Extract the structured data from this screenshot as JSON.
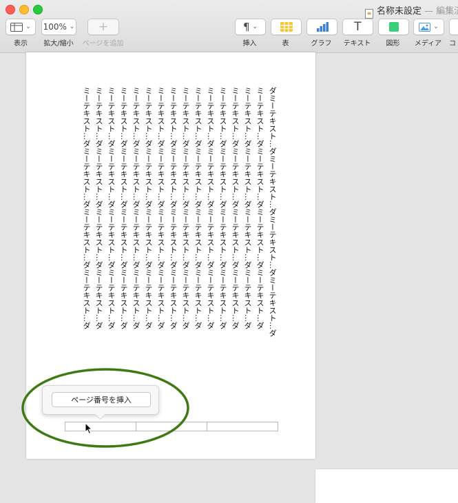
{
  "window": {
    "title": "名称未設定",
    "status": "— 編集済"
  },
  "toolbar": {
    "view": {
      "label": "表示"
    },
    "zoom": {
      "value": "100%",
      "label": "拡大/縮小"
    },
    "add_page": {
      "symbol": "+",
      "label": "ページを追加"
    },
    "insert": {
      "symbol": "¶",
      "label": "挿入"
    },
    "table": {
      "label": "表"
    },
    "chart": {
      "label": "グラフ"
    },
    "text": {
      "symbol": "T",
      "label": "テキスト"
    },
    "shape": {
      "label": "図形"
    },
    "media": {
      "label": "メディア"
    },
    "comment": {
      "label": "コ"
    }
  },
  "document": {
    "columns": [
      "ダミーテキスト…ダミーテキスト…ダミーテキスト…ダミーテキスト…ダ",
      "ミーテキスト…ダミーテキスト…ダミーテキスト…ダミーテキスト…ダ",
      "ミーテキスト…ダミーテキスト…ダミーテキスト…ダミーテキスト…ダ",
      "ミーテキスト…ダミーテキスト…ダミーテキスト…ダミーテキスト…ダ",
      "ミーテキスト…ダミーテキスト…ダミーテキスト…ダミーテキスト…ダ",
      "ミーテキスト…ダミーテキスト…ダミーテキスト…ダミーテキスト…ダ",
      "ミーテキスト…ダミーテキスト…ダミーテキスト…ダミーテキスト…ダ",
      "ミーテキスト…ダミーテキスト…ダミーテキスト…ダミーテキスト…ダ",
      "ミーテキスト…ダミーテキスト…ダミーテキスト…ダミーテキスト…ダ",
      "ミーテキスト…ダミーテキスト…ダミーテキスト…ダミーテキスト…ダ",
      "ミーテキスト…ダミーテキスト…ダミーテキスト…ダミーテキスト…ダ",
      "ミーテキスト…ダミーテキスト…ダミーテキスト…ダミーテキスト…ダ",
      "ミーテキスト…ダミーテキスト…ダミーテキスト…ダミーテキスト…ダ",
      "ミーテキスト…ダミーテキスト…ダミーテキスト…ダミーテキスト…ダ",
      "ミーテキスト…ダミーテキスト…ダミーテキスト…ダミーテキスト…ダ",
      "ミーテキスト…ダミーテキスト…ダミーテキスト…ダミーテキスト…ダ"
    ]
  },
  "popover": {
    "button_label": "ページ番号を挿入"
  },
  "colors": {
    "annotation_ellipse": "#3d7a12",
    "table_icon": "#f7c531",
    "chart_icon": "#3b82d6",
    "shape_icon": "#3ccf7a",
    "media_icon": "#4a9be0"
  }
}
